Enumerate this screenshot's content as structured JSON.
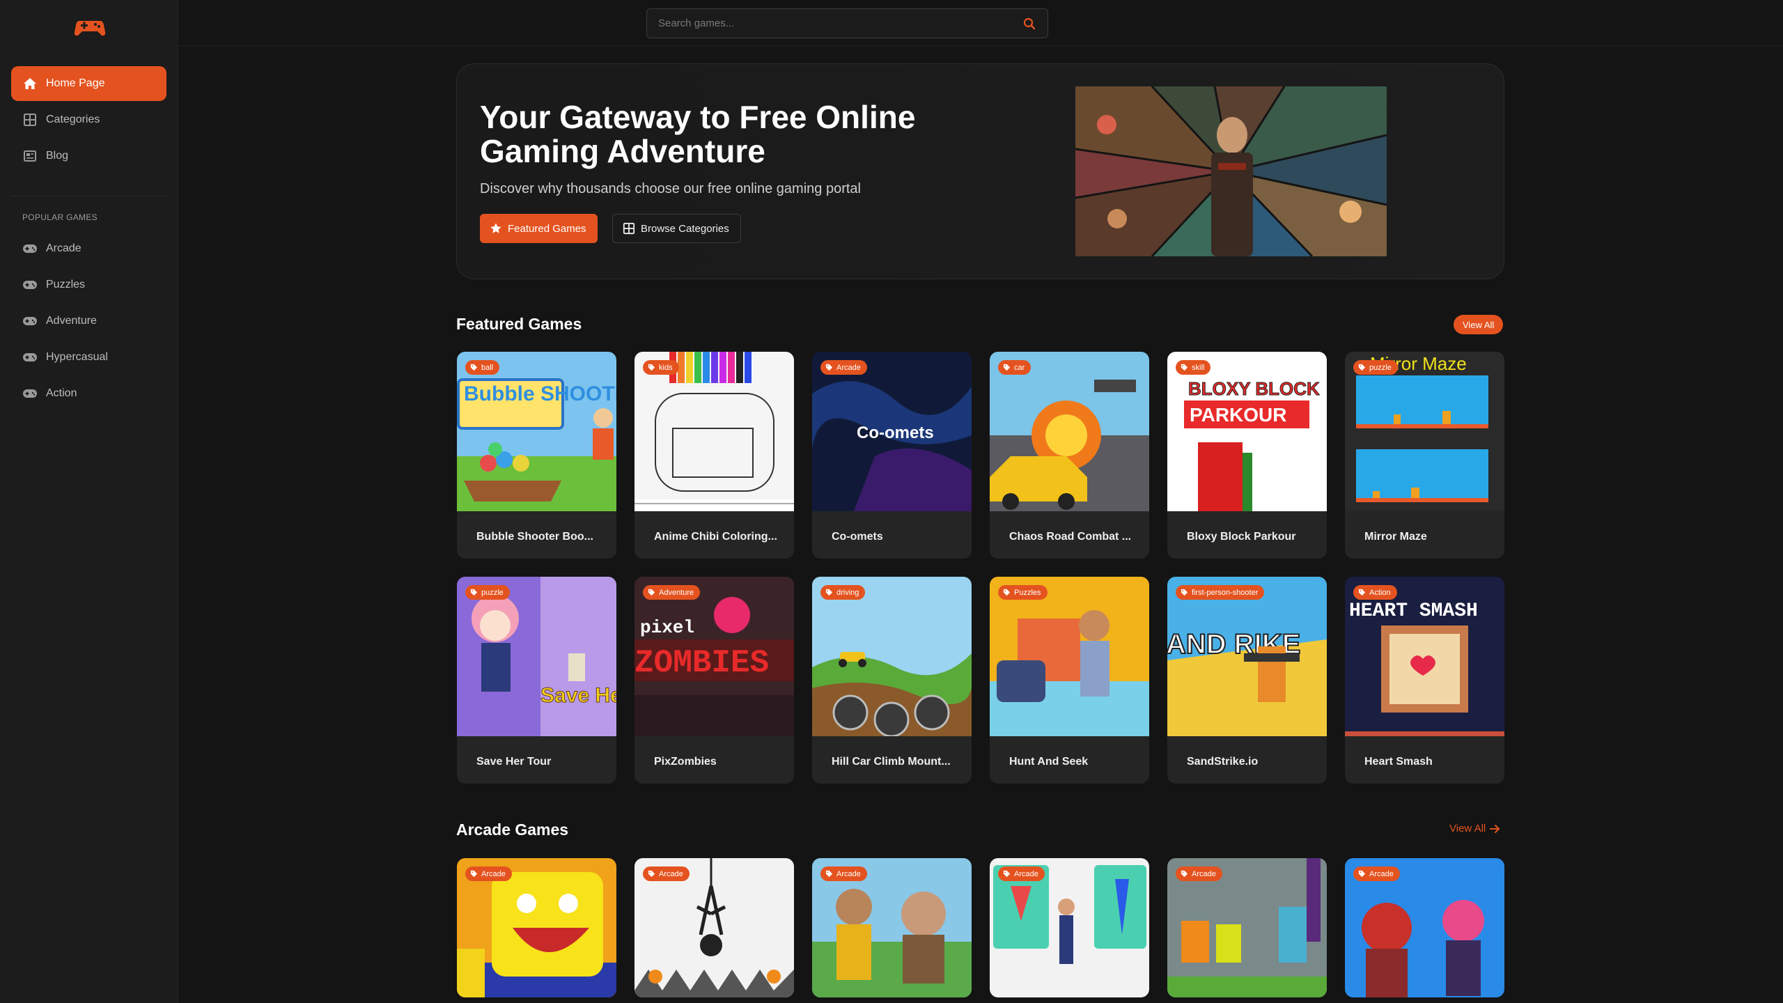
{
  "search": {
    "placeholder": "Search games..."
  },
  "sidebar": {
    "nav": [
      {
        "label": "Home Page",
        "icon": "home-icon",
        "active": true
      },
      {
        "label": "Categories",
        "icon": "grid-icon",
        "active": false
      },
      {
        "label": "Blog",
        "icon": "newspaper-icon",
        "active": false
      }
    ],
    "popular_title": "POPULAR GAMES",
    "popular": [
      {
        "label": "Arcade",
        "icon": "gamepad-icon"
      },
      {
        "label": "Puzzles",
        "icon": "gamepad-icon"
      },
      {
        "label": "Adventure",
        "icon": "gamepad-icon"
      },
      {
        "label": "Hypercasual",
        "icon": "gamepad-icon"
      },
      {
        "label": "Action",
        "icon": "gamepad-icon"
      }
    ]
  },
  "hero": {
    "title": "Your Gateway to Free Online Gaming Adventure",
    "subtitle": "Discover why thousands choose our free online gaming portal",
    "primary_btn": "Featured Games",
    "secondary_btn": "Browse Categories"
  },
  "featured": {
    "title": "Featured Games",
    "view_all": "View All",
    "games": [
      {
        "name": "Bubble Shooter Boo...",
        "tag": "ball"
      },
      {
        "name": "Anime Chibi Coloring...",
        "tag": "kids"
      },
      {
        "name": "Co-omets",
        "tag": "Arcade"
      },
      {
        "name": "Chaos Road Combat ...",
        "tag": "car"
      },
      {
        "name": "Bloxy Block Parkour",
        "tag": "skill"
      },
      {
        "name": "Mirror Maze",
        "tag": "puzzle"
      },
      {
        "name": "Save Her Tour",
        "tag": "puzzle"
      },
      {
        "name": "PixZombies",
        "tag": "Adventure"
      },
      {
        "name": "Hill Car Climb Mount...",
        "tag": "driving"
      },
      {
        "name": "Hunt And Seek",
        "tag": "Puzzles"
      },
      {
        "name": "SandStrike.io",
        "tag": "first-person-shooter"
      },
      {
        "name": "Heart Smash",
        "tag": "Action"
      }
    ],
    "thumb_text": {
      "g0": "Bubble SHOOTER",
      "g2": "Co-omets",
      "g4a": "BLOXY BLOCK",
      "g4b": "PARKOUR",
      "g5": "Mirror Maze",
      "g6": "Save Her To",
      "g7a": "pixel",
      "g7b": "ZOMBIES",
      "g10": "AND RIKE",
      "g11": "HEART SMASH"
    }
  },
  "arcade": {
    "title": "Arcade Games",
    "view_all": "View All",
    "tags": [
      "Arcade",
      "Arcade",
      "Arcade",
      "Arcade",
      "Arcade",
      "Arcade"
    ]
  },
  "colors": {
    "accent": "#e4531f",
    "bg": "#141414",
    "sidebar": "#1c1c1c",
    "card": "#252525"
  }
}
